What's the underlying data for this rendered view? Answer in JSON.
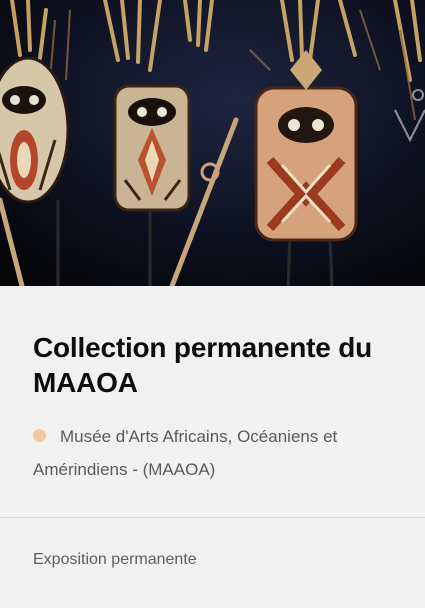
{
  "card": {
    "image_alt": "Masques océaniens exposés",
    "title": "Collection permanente du MAAOA",
    "venue": "Musée d'Arts Africains, Océaniens et Amérindiens - (MAAOA)",
    "venue_dot_color": "#f2c9a2",
    "tag": "Exposition permanente"
  }
}
